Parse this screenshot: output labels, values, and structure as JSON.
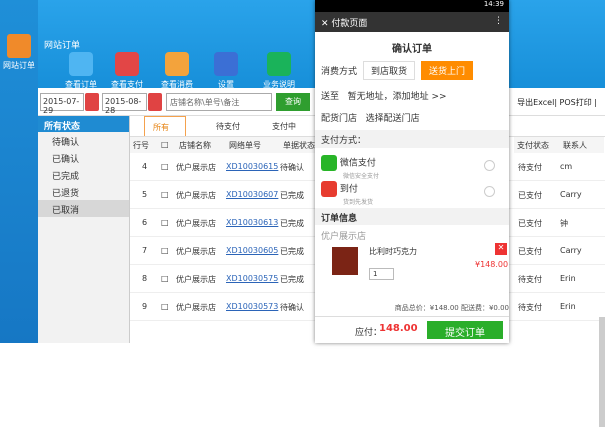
{
  "app": {
    "title": "网站订单",
    "side_label": "网站订单"
  },
  "toolbar": [
    {
      "label": "查看订单"
    },
    {
      "label": "查看支付"
    },
    {
      "label": "查看消费"
    },
    {
      "label": "设置"
    },
    {
      "label": "业务说明"
    }
  ],
  "filter": {
    "date_from": "2015-07-29",
    "date_to": "2015-08-28",
    "search_placeholder": "店铺名称\\单号\\备注",
    "search_button": "查询"
  },
  "export": "导出Excel| POS打印 |",
  "sidebar": {
    "title": "所有状态",
    "items": [
      "待确认",
      "已确认",
      "已完成",
      "已退货",
      "已取消"
    ]
  },
  "tabs": [
    "所有",
    "待支付",
    "支付中"
  ],
  "columns": [
    "行号",
    "",
    "店铺名称",
    "网络单号",
    "单据状态",
    "支付状态",
    "联系人"
  ],
  "rows": [
    {
      "no": "4",
      "shop": "优户展示店",
      "order": "XD10030615",
      "status": "待确认",
      "pay": "待支付",
      "contact": "cm"
    },
    {
      "no": "5",
      "shop": "优户展示店",
      "order": "XD10030607",
      "status": "已完成",
      "pay": "已支付",
      "contact": "Carry"
    },
    {
      "no": "6",
      "shop": "优户展示店",
      "order": "XD10030613",
      "status": "已完成",
      "pay": "已支付",
      "contact": "钟"
    },
    {
      "no": "7",
      "shop": "优户展示店",
      "order": "XD10030605",
      "status": "已完成",
      "pay": "已支付",
      "contact": "Carry"
    },
    {
      "no": "8",
      "shop": "优户展示店",
      "order": "XD10030575",
      "status": "已完成",
      "pay": "待支付",
      "contact": "Erin"
    },
    {
      "no": "9",
      "shop": "优户展示店",
      "order": "XD10030573",
      "status": "待确认",
      "pay": "待支付",
      "contact": "Erin"
    }
  ],
  "phone": {
    "time": "14:39",
    "page_title": "付款页面",
    "confirm_title": "确认订单",
    "consume_label": "消费方式",
    "pickup": "到店取货",
    "delivery": "送货上门",
    "address_label": "送至",
    "address_value": "暂无地址，添加地址 >>",
    "store_label": "配货门店",
    "store_value": "选择配送门店",
    "payment_label": "支付方式：",
    "wechat": "微信支付",
    "wechat_sub": "微信安全支付",
    "cod": "到付",
    "cod_sub": "货到先发货",
    "order_info": "订单信息",
    "shop": "优户展示店",
    "product": "比利时巧克力",
    "qty": "1",
    "price": "¥148.00",
    "summary": "商品总价：¥148.00  配送费：¥0.00",
    "payable_label": "应付：",
    "payable": "148.00",
    "submit": "提交订单"
  },
  "colors": {
    "blue": "#1f8fd8",
    "orange": "#ff8c00",
    "green": "#2aae2a",
    "red": "#e33333"
  }
}
